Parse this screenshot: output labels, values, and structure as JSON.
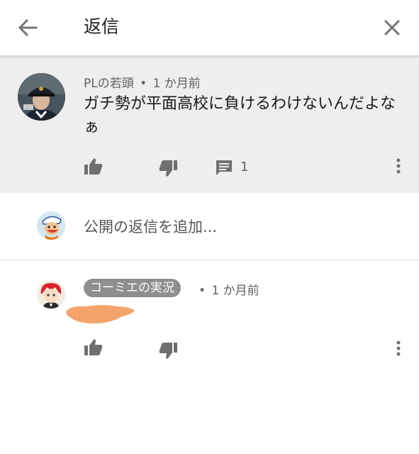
{
  "header": {
    "title": "返信",
    "back_icon": "arrow-left-icon",
    "close_icon": "close-icon"
  },
  "parent_comment": {
    "author": "PLの若頭",
    "separator": "•",
    "time": "1 か月前",
    "text": "ガチ勢が平面高校に負けるわけないんだよなぁ",
    "reply_count": "1"
  },
  "add_reply": {
    "placeholder": "公開の返信を追加..."
  },
  "reply": {
    "author": "コーミエの実況",
    "separator": "•",
    "time": "1 か月前",
    "redaction_color": "#f4a46a"
  },
  "colors": {
    "parent_bg": "#eeeeee",
    "icon_gray": "#757575",
    "chip_bg": "#8e8e8e"
  }
}
